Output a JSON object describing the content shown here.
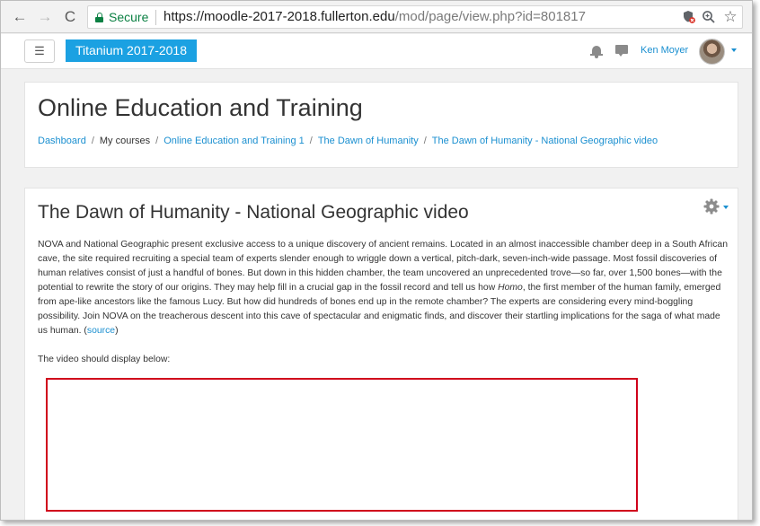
{
  "browser": {
    "back_icon": "←",
    "forward_icon": "→",
    "reload_icon": "C",
    "secure_label": "Secure",
    "url_host": "https://moodle-2017-2018.fullerton.edu",
    "url_path": "/mod/page/view.php?id=801817",
    "zoom_icon": "⊕",
    "star_icon": "☆"
  },
  "navbar": {
    "menu_icon": "☰",
    "brand": "Titanium 2017-2018",
    "user_name": "Ken Moyer",
    "accent_color": "#1ba1e2"
  },
  "header": {
    "title": "Online Education and Training",
    "breadcrumb": [
      "Dashboard",
      "My courses",
      "Online Education and Training 1",
      "The Dawn of Humanity",
      "The Dawn of Humanity - National Geographic video"
    ]
  },
  "content": {
    "title": "The Dawn of Humanity - National Geographic video",
    "paragraph_part1": "NOVA and National Geographic present exclusive access to a unique discovery of ancient remains. Located in an almost inaccessible chamber deep in a South African cave, the site required recruiting a special team of experts slender enough to wriggle down a vertical, pitch-dark, seven-inch-wide passage. Most fossil discoveries of human relatives consist of just a handful of bones. But down in this hidden chamber, the team uncovered an unprecedented trove—so far, over 1,500 bones—with the potential to rewrite the story of our origins. They may help fill in a crucial gap in the fossil record and tell us how ",
    "paragraph_italic": "Homo",
    "paragraph_part2": ", the first member of the human family, emerged from ape-like ancestors like the famous Lucy. But how did hundreds of bones end up in the remote chamber? The experts are considering every mind-boggling possibility. Join NOVA on the treacherous descent into this cave of spectacular and enigmatic finds, and discover their startling implications for the saga of what made us human. (",
    "source_link": "source",
    "paragraph_end": ")",
    "video_note": "The video should display below:",
    "video_border_color": "#d0021b"
  }
}
